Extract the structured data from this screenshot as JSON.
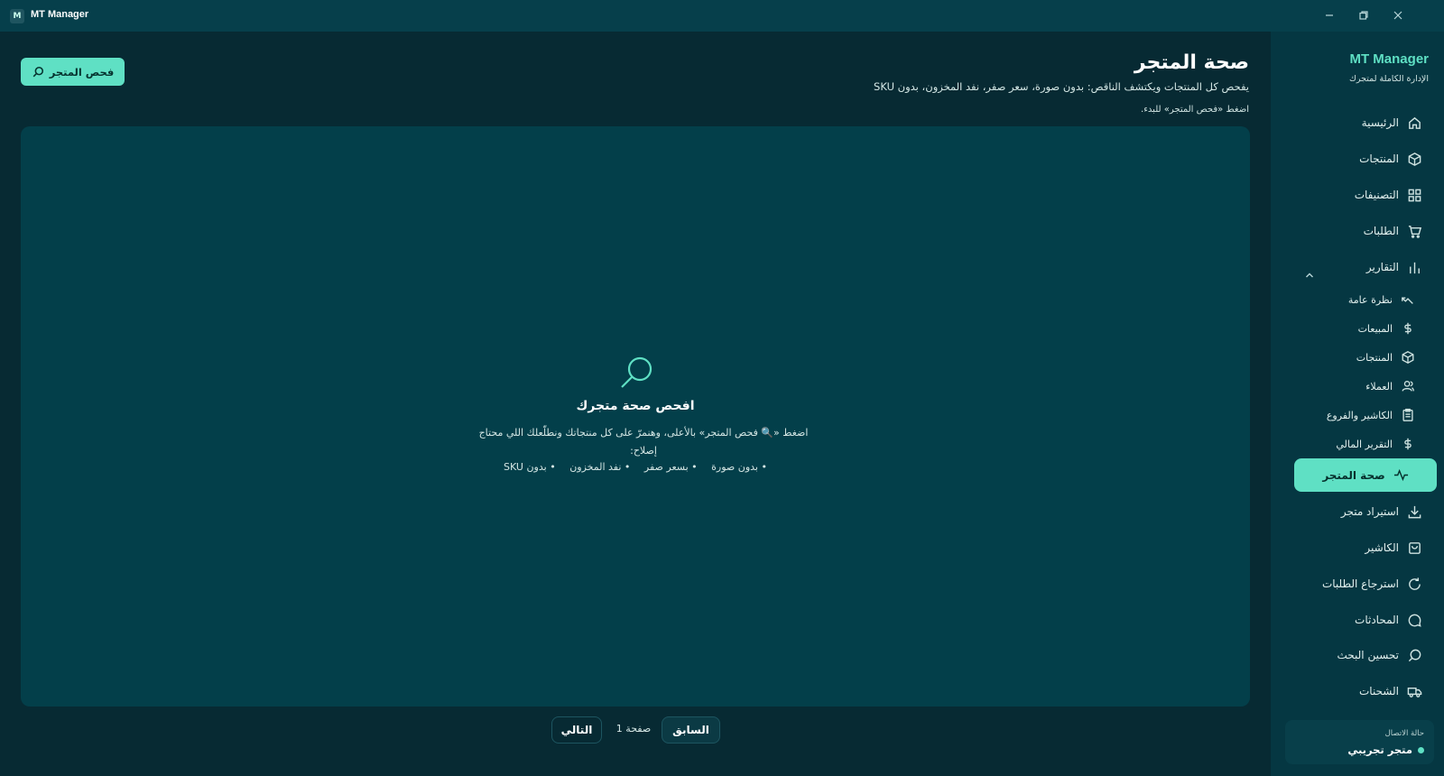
{
  "app": {
    "title": "MT Manager",
    "logo_text": "M"
  },
  "header": {
    "title": "صحة المتجر",
    "subtitle": "يفحص كل المنتجات ويكتشف الناقص: بدون صورة، سعر صفر، نفد المخزون، بدون SKU",
    "hint": "اضغط «فحص المتجر» للبدء.",
    "scan_button": "فحص المتجر"
  },
  "empty_state": {
    "title": "افحص صحة متجرك",
    "description": "اضغط «🔍 فحص المتجر» بالأعلى، وهنمرّ على كل منتجاتك ونطلّعلك اللي محتاج إصلاح:",
    "checks": [
      "• بدون صورة",
      "• بسعر صفر",
      "• نفد المخزون",
      "• بدون SKU"
    ]
  },
  "pagination": {
    "prev": "السابق",
    "page_label": "صفحة 1",
    "next": "التالي"
  },
  "sidebar": {
    "brand": "MT Manager",
    "tagline": "الإدارة الكاملة لمتجرك",
    "items": [
      {
        "label": "الرئيسية",
        "icon": "home-icon"
      },
      {
        "label": "المنتجات",
        "icon": "box-icon"
      },
      {
        "label": "التصنيفات",
        "icon": "grid-icon"
      },
      {
        "label": "الطلبات",
        "icon": "cart-icon"
      },
      {
        "label": "التقارير",
        "icon": "bar-chart-icon"
      }
    ],
    "reports_sub": [
      {
        "label": "نظرة عامة",
        "icon": "trend-icon"
      },
      {
        "label": "المبيعات",
        "icon": "dollar-icon"
      },
      {
        "label": "المنتجات",
        "icon": "box-icon"
      },
      {
        "label": "العملاء",
        "icon": "users-icon"
      },
      {
        "label": "الكاشير والفروع",
        "icon": "clipboard-icon"
      },
      {
        "label": "التقرير المالي",
        "icon": "dollar-icon"
      }
    ],
    "items_after": [
      {
        "label": "صحة المتجر",
        "icon": "pulse-icon"
      },
      {
        "label": "استيراد متجر",
        "icon": "download-icon"
      },
      {
        "label": "الكاشير",
        "icon": "bag-icon"
      },
      {
        "label": "استرجاع الطلبات",
        "icon": "refresh-icon"
      },
      {
        "label": "المحادثات",
        "icon": "chat-icon"
      },
      {
        "label": "تحسين البحث",
        "icon": "search-icon"
      },
      {
        "label": "الشحنات",
        "icon": "truck-icon"
      }
    ],
    "connection": {
      "label": "حالة الاتصال",
      "value": "متجر تجريبي"
    }
  },
  "colors": {
    "accent": "#5fe0c4",
    "background": "#072a33",
    "panel": "#033f4a",
    "sidebar": "#053742"
  }
}
